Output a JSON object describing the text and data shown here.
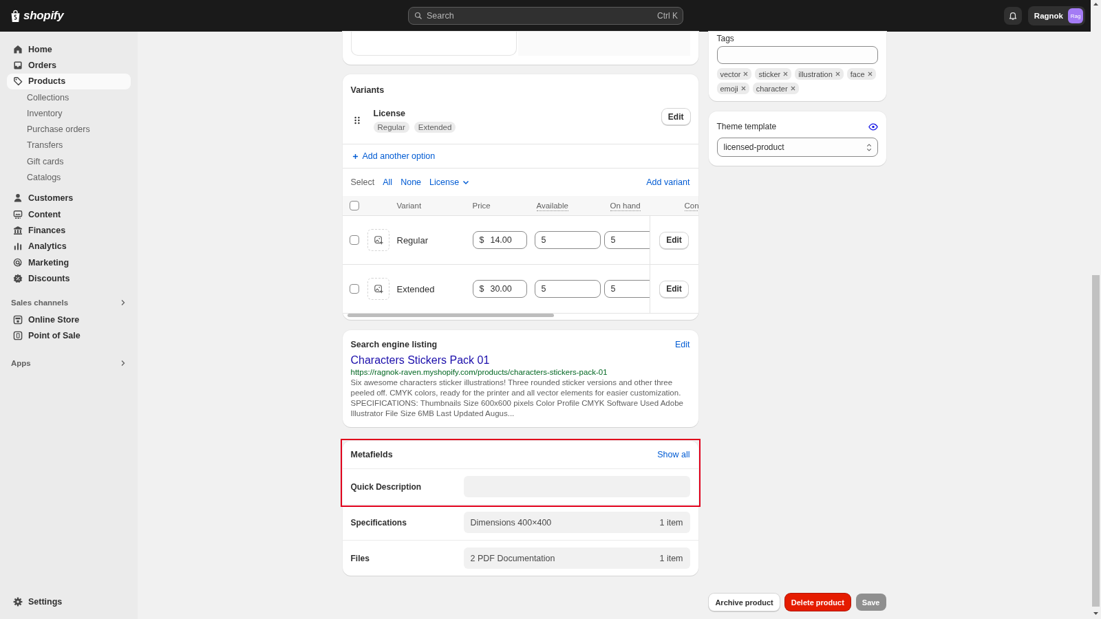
{
  "topbar": {
    "logo": "shopify",
    "search": {
      "placeholder": "Search",
      "shortcut": "Ctrl K"
    },
    "user": {
      "name": "Ragnok",
      "initials": "Rag"
    }
  },
  "sidebar": {
    "items": [
      {
        "label": "Home",
        "selected": false
      },
      {
        "label": "Orders",
        "selected": false
      },
      {
        "label": "Products",
        "selected": true,
        "children": [
          {
            "label": "Collections",
            "selected": false
          },
          {
            "label": "Inventory",
            "selected": false
          },
          {
            "label": "Purchase orders",
            "selected": false
          },
          {
            "label": "Transfers",
            "selected": false
          },
          {
            "label": "Gift cards",
            "selected": false
          },
          {
            "label": "Catalogs",
            "selected": false
          }
        ]
      },
      {
        "label": "Customers",
        "selected": false
      },
      {
        "label": "Content",
        "selected": false
      },
      {
        "label": "Finances",
        "selected": false
      },
      {
        "label": "Analytics",
        "selected": false
      },
      {
        "label": "Marketing",
        "selected": false
      },
      {
        "label": "Discounts",
        "selected": false
      }
    ],
    "sales_channels": {
      "title": "Sales channels",
      "items": [
        {
          "label": "Online Store",
          "selected": false
        },
        {
          "label": "Point of Sale",
          "selected": false
        }
      ]
    },
    "apps": {
      "title": "Apps"
    },
    "settings": {
      "label": "Settings"
    }
  },
  "variants": {
    "title": "Variants",
    "option": {
      "name": "License",
      "values": [
        "Regular",
        "Extended"
      ],
      "action": "Edit"
    },
    "add_option": "Add another option",
    "select": {
      "label": "Select",
      "links": [
        "All",
        "None"
      ],
      "filter": "License"
    },
    "add_variant": "Add variant",
    "table": {
      "select_all_checked": false,
      "columns": [
        "Variant",
        "Price",
        "Available",
        "On hand",
        "Con"
      ],
      "rows": [
        {
          "checked": false,
          "name": "Regular",
          "currency": "$",
          "price": "14.00",
          "available": "5",
          "on_hand": "5",
          "action": "Edit"
        },
        {
          "checked": false,
          "name": "Extended",
          "currency": "$",
          "price": "30.00",
          "available": "5",
          "on_hand": "5",
          "action": "Edit"
        }
      ]
    }
  },
  "search_listing": {
    "title": "Search engine listing",
    "action": "Edit",
    "page_title": "Characters Stickers Pack 01",
    "url": "https://ragnok-raven.myshopify.com/products/characters-stickers-pack-01",
    "description": "Six awesome characters sticker illustrations! Three rounded sticker versions and other three peeled off. CMYK colors, ready for the printer and all vector elements for easier customization. SPECIFICATIONS: Thumbnails Size 600x600 pixels Color Profile CMYK Software Used Adobe Illustrator File Size 6MB Last Updated Augus..."
  },
  "metafields": {
    "title": "Metafields",
    "action": "Show all",
    "rows": [
      {
        "label": "Quick Description",
        "highlighted": true
      },
      {
        "label": "Specifications",
        "value": "Dimensions 400×400",
        "count": "1 item",
        "highlighted": false
      },
      {
        "label": "Files",
        "value": "2 PDF Documentation",
        "count": "1 item",
        "highlighted": false
      }
    ]
  },
  "tags": {
    "label": "Tags",
    "items": [
      "vector",
      "sticker",
      "illustration",
      "face",
      "emoji",
      "character"
    ]
  },
  "theme_template": {
    "label": "Theme template",
    "value": "licensed-product"
  },
  "actions": [
    {
      "label": "Archive product",
      "kind": "secondary",
      "disabled": false
    },
    {
      "label": "Delete product",
      "kind": "critical",
      "disabled": false
    },
    {
      "label": "Save",
      "kind": "primary",
      "disabled": true
    }
  ]
}
